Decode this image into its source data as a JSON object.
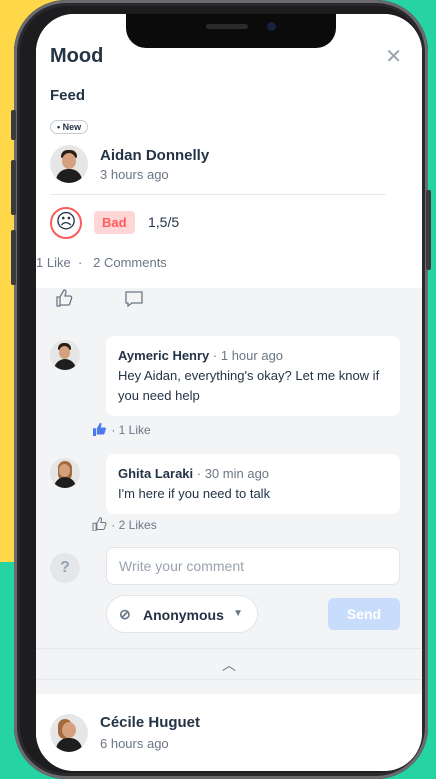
{
  "modal": {
    "title": "Mood",
    "close_icon": "close-icon"
  },
  "feed": {
    "label": "Feed"
  },
  "post": {
    "badge": "• New",
    "author": "Aidan Donnelly",
    "time": "3 hours ago",
    "mood_icon": "sad-face-icon",
    "mood_label": "Bad",
    "score": "1,5/5",
    "likes_text": "1 Like",
    "comments_text": "2 Comments"
  },
  "comments": [
    {
      "author": "Aymeric Henry",
      "time": "· 1 hour ago",
      "text": "Hey Aidan, everything's okay? Let me know if you need help",
      "likes": "· 1 Like",
      "liked": true
    },
    {
      "author": "Ghita Laraki",
      "time": "· 30 min ago",
      "text": "I'm here if you need to talk",
      "likes": "· 2 Likes",
      "liked": false
    }
  ],
  "composer": {
    "help_symbol": "?",
    "placeholder": "Write your comment",
    "visibility": "Anonymous",
    "send_label": "Send"
  },
  "next_post": {
    "author": "Cécile Huguet",
    "time": "6 hours ago"
  },
  "colors": {
    "accent": "#4a7cf0",
    "bad": "#ff5b5b",
    "background": "#26d3a3",
    "yellow": "#ffd84a"
  }
}
